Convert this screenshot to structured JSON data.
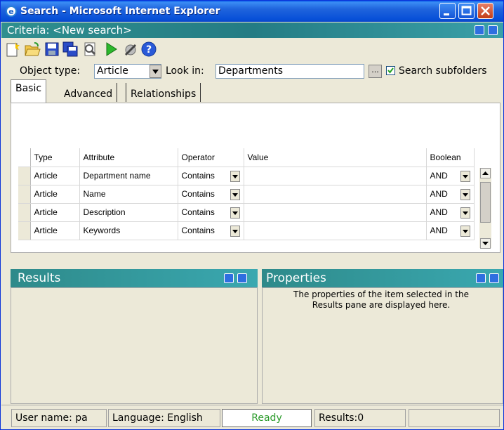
{
  "window": {
    "title": "Search - Microsoft Internet Explorer"
  },
  "criteria": {
    "title": "Criteria: <New search>"
  },
  "toolbar": {
    "icons": [
      "new-icon",
      "open-folder-icon",
      "save-icon",
      "save-all-icon",
      "preview-icon",
      "run-icon",
      "tools-icon",
      "help-icon"
    ]
  },
  "object_row": {
    "object_type_label": "Object type:",
    "object_type_value": "Article",
    "look_in_label": "Look in:",
    "look_in_value": "Departments",
    "browse_label": "...",
    "search_subfolders_label": "Search subfolders",
    "search_subfolders_checked": true
  },
  "tabs": [
    {
      "label": "Basic",
      "active": true
    },
    {
      "label": "Advanced",
      "active": false
    },
    {
      "label": "Relationships",
      "active": false
    }
  ],
  "grid": {
    "headers": [
      "Type",
      "Attribute",
      "Operator",
      "Value",
      "Boolean"
    ],
    "rows": [
      {
        "type": "Article",
        "attribute": "Department name",
        "operator": "Contains",
        "value": "",
        "boolean": "AND"
      },
      {
        "type": "Article",
        "attribute": "Name",
        "operator": "Contains",
        "value": "",
        "boolean": "AND"
      },
      {
        "type": "Article",
        "attribute": "Description",
        "operator": "Contains",
        "value": "",
        "boolean": "AND"
      },
      {
        "type": "Article",
        "attribute": "Keywords",
        "operator": "Contains",
        "value": "",
        "boolean": "AND"
      }
    ]
  },
  "results": {
    "title": "Results"
  },
  "properties": {
    "title": "Properties",
    "text_line1": "The properties of the item selected in the",
    "text_line2": "Results pane are displayed here."
  },
  "status": {
    "user": "User name: pa",
    "language": "Language: English",
    "state": "Ready",
    "results": "Results:0"
  },
  "colors": {
    "title_bar": "#0750d8",
    "pane_header": "#2e8a8a",
    "ready": "#2a9a2a"
  }
}
